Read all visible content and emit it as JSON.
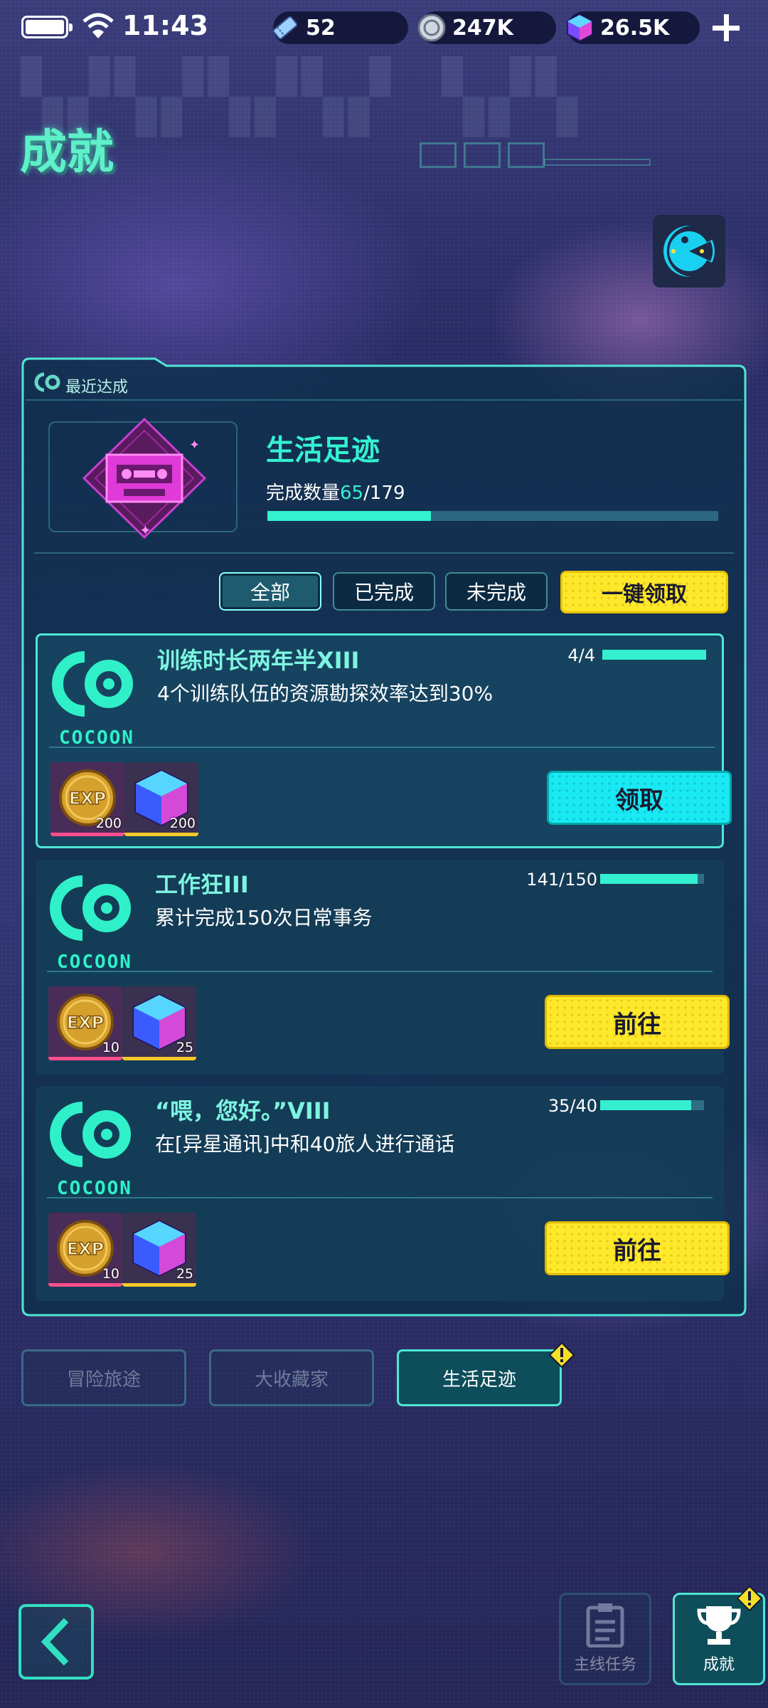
{
  "status_bar": {
    "time": "11:43",
    "resources": [
      {
        "icon": "ticket-icon",
        "value": "52"
      },
      {
        "icon": "coin-icon",
        "value": "247K"
      },
      {
        "icon": "crystal-cube-icon",
        "value": "26.5K"
      }
    ]
  },
  "header": {
    "title": "成就"
  },
  "recent": {
    "label": "最近达成",
    "category_name": "生活足迹",
    "count_label": "完成数量",
    "count_done": "65",
    "count_total": "/179",
    "progress": 0.363
  },
  "filters": [
    {
      "label": "全部",
      "active": true
    },
    {
      "label": "已完成",
      "active": false
    },
    {
      "label": "未完成",
      "active": false
    }
  ],
  "claim_all_label": "一键领取",
  "achievements": [
    {
      "title": "训练时长两年半XIII",
      "description": "4个训练队伍的资源勘探效率达到30%",
      "progress_text": "4/4",
      "progress": 1.0,
      "logo_text": "COCOON",
      "rewards": [
        {
          "icon": "exp-coin-icon",
          "qty": "200"
        },
        {
          "icon": "crystal-cube-icon",
          "qty": "200"
        }
      ],
      "button_label": "领取",
      "button_style": "cyan"
    },
    {
      "title": "工作狂III",
      "description": "累计完成150次日常事务",
      "progress_text": "141/150",
      "progress": 0.94,
      "logo_text": "COCOON",
      "rewards": [
        {
          "icon": "exp-coin-icon",
          "qty": "10"
        },
        {
          "icon": "crystal-cube-icon",
          "qty": "25"
        }
      ],
      "button_label": "前往",
      "button_style": "yellow"
    },
    {
      "title": "“喂，您好。”VIII",
      "description": "在[异星通讯]中和40旅人进行通话",
      "progress_text": "35/40",
      "progress": 0.875,
      "logo_text": "COCOON",
      "rewards": [
        {
          "icon": "exp-coin-icon",
          "qty": "10"
        },
        {
          "icon": "crystal-cube-icon",
          "qty": "25"
        }
      ],
      "button_label": "前往",
      "button_style": "yellow"
    }
  ],
  "category_tabs": [
    {
      "label": "冒险旅途",
      "active": false
    },
    {
      "label": "大收藏家",
      "active": false
    },
    {
      "label": "生活足迹",
      "active": true
    }
  ],
  "bottom_nav": {
    "main_quest_label": "主线任务",
    "achievements_label": "成就"
  },
  "colors": {
    "accent": "#34f2d0",
    "yellow_button": "#fde82a",
    "cyan_button": "#19e9f3",
    "alert": "#f5e02a"
  }
}
